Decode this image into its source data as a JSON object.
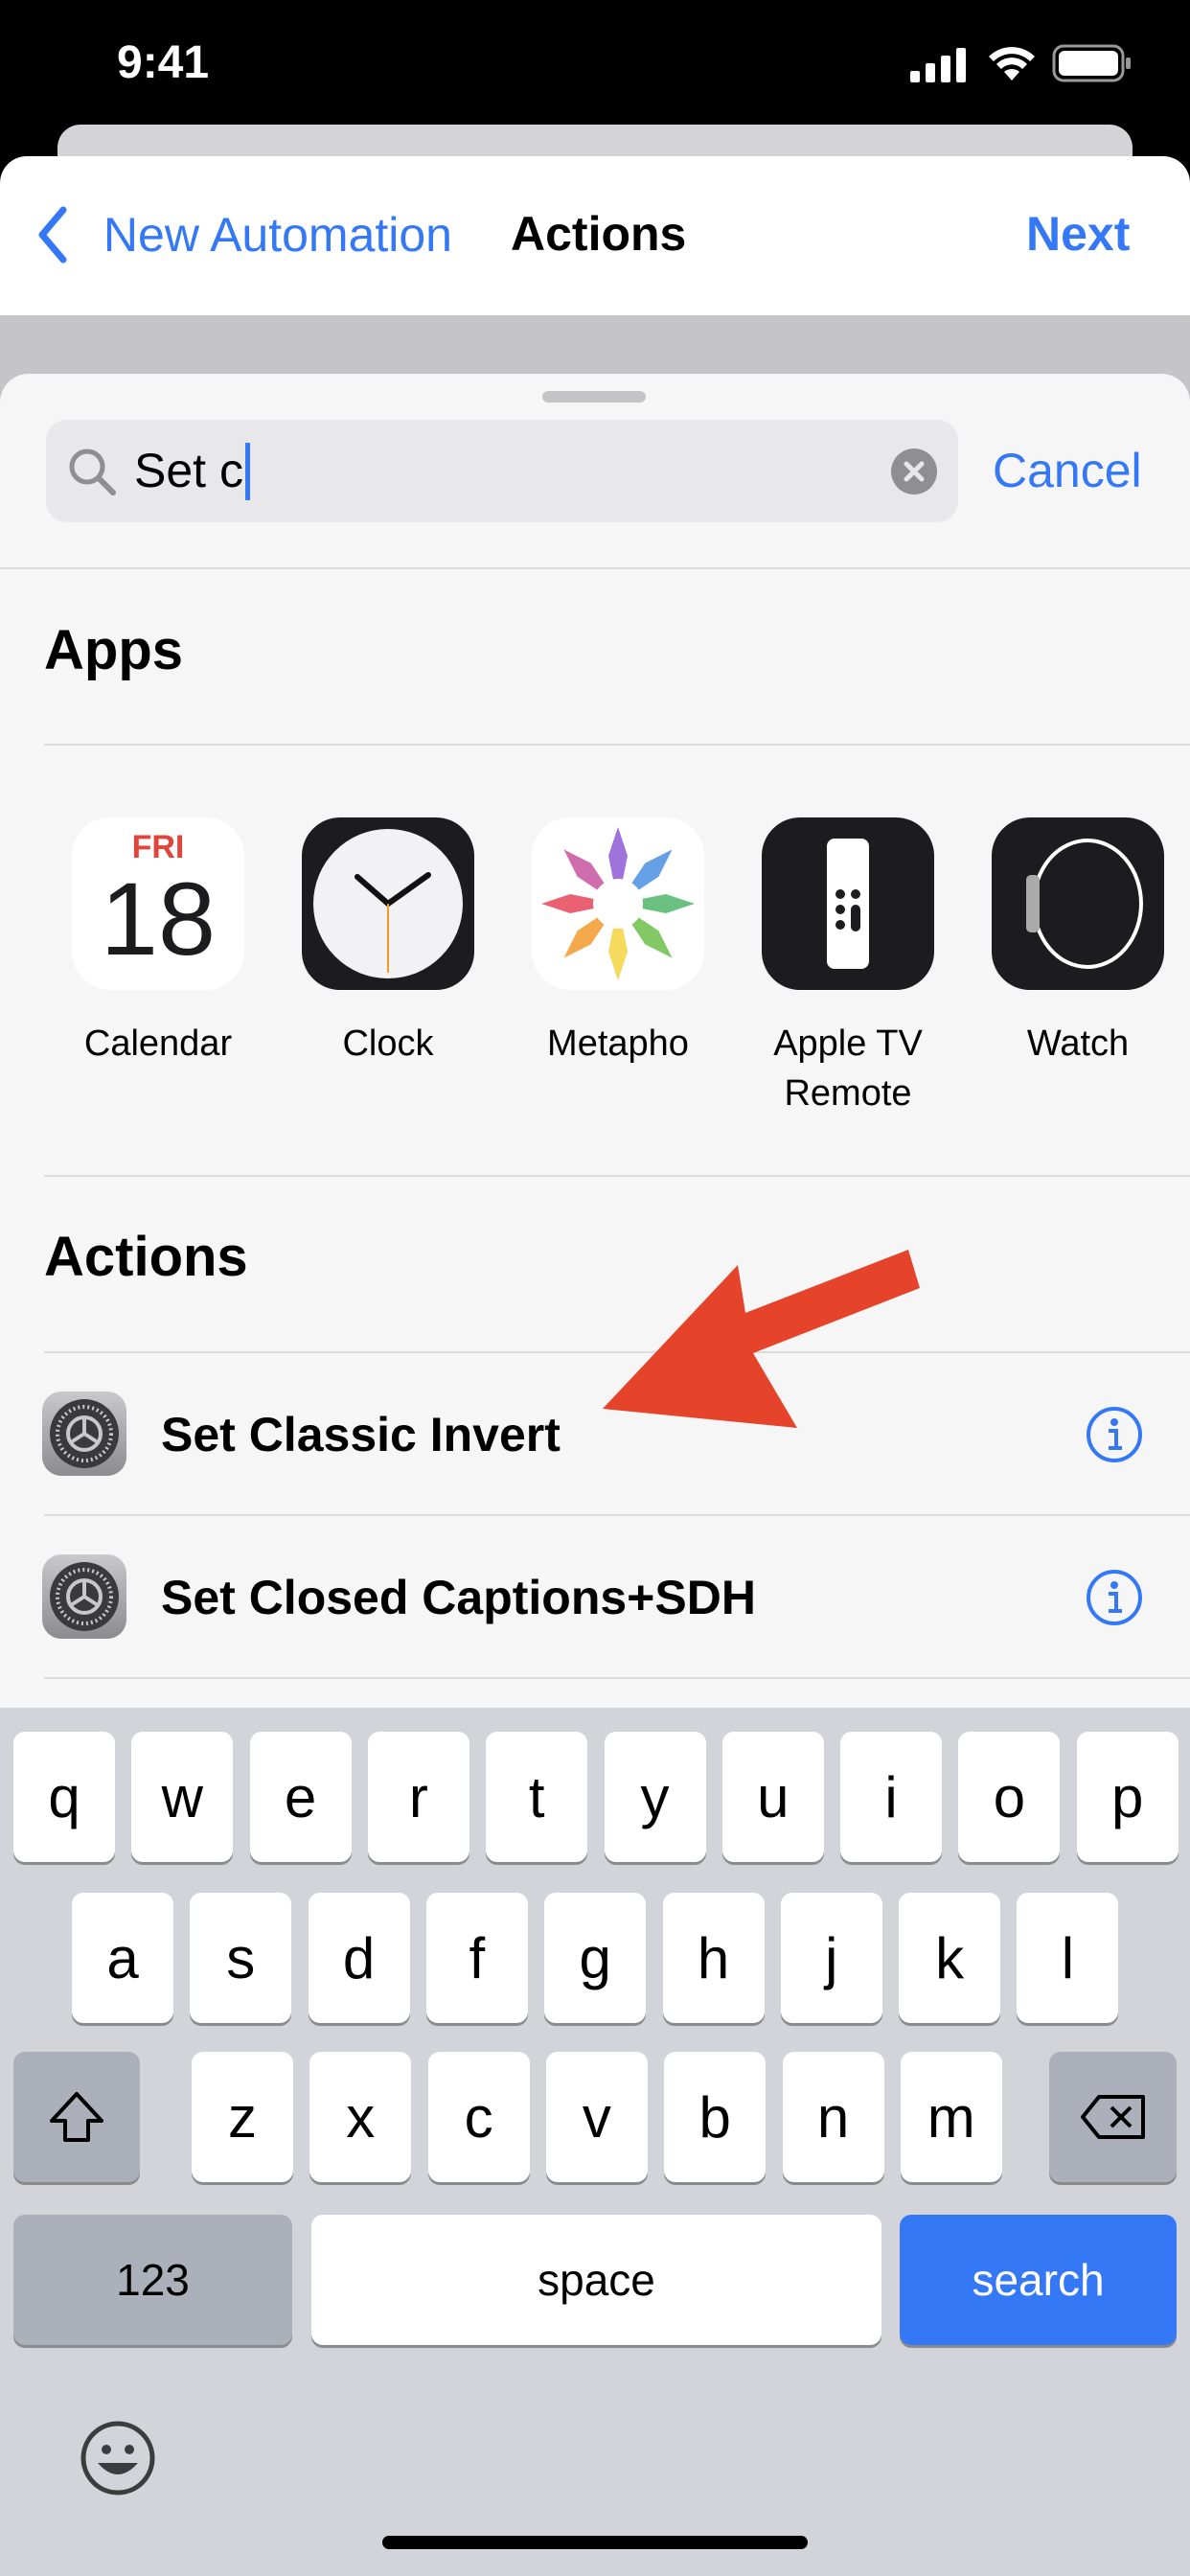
{
  "status": {
    "time": "9:41"
  },
  "nav": {
    "back": "New Automation",
    "title": "Actions",
    "next": "Next"
  },
  "search": {
    "value": "Set c",
    "cancel": "Cancel"
  },
  "apps": {
    "heading": "Apps",
    "items": [
      {
        "label": "Calendar",
        "icon": "calendar-icon",
        "day": "FRI",
        "date": "18"
      },
      {
        "label": "Clock",
        "icon": "clock-icon"
      },
      {
        "label": "Metapho",
        "icon": "metapho-icon"
      },
      {
        "label": "Apple TV\nRemote",
        "icon": "apple-tv-remote-icon"
      },
      {
        "label": "Watch",
        "icon": "watch-icon"
      }
    ]
  },
  "actions": {
    "heading": "Actions",
    "items": [
      {
        "label": "Set Classic Invert",
        "icon": "settings-gear-icon"
      },
      {
        "label": "Set Closed Captions+SDH",
        "icon": "settings-gear-icon"
      }
    ]
  },
  "keyboard": {
    "rows": [
      [
        "q",
        "w",
        "e",
        "r",
        "t",
        "y",
        "u",
        "i",
        "o",
        "p"
      ],
      [
        "a",
        "s",
        "d",
        "f",
        "g",
        "h",
        "j",
        "k",
        "l"
      ],
      [
        "z",
        "x",
        "c",
        "v",
        "b",
        "n",
        "m"
      ]
    ],
    "numbers": "123",
    "space": "space",
    "search": "search"
  },
  "colors": {
    "accent": "#3478f6",
    "arrow": "#e5432a",
    "search_key": "#3478f6"
  }
}
